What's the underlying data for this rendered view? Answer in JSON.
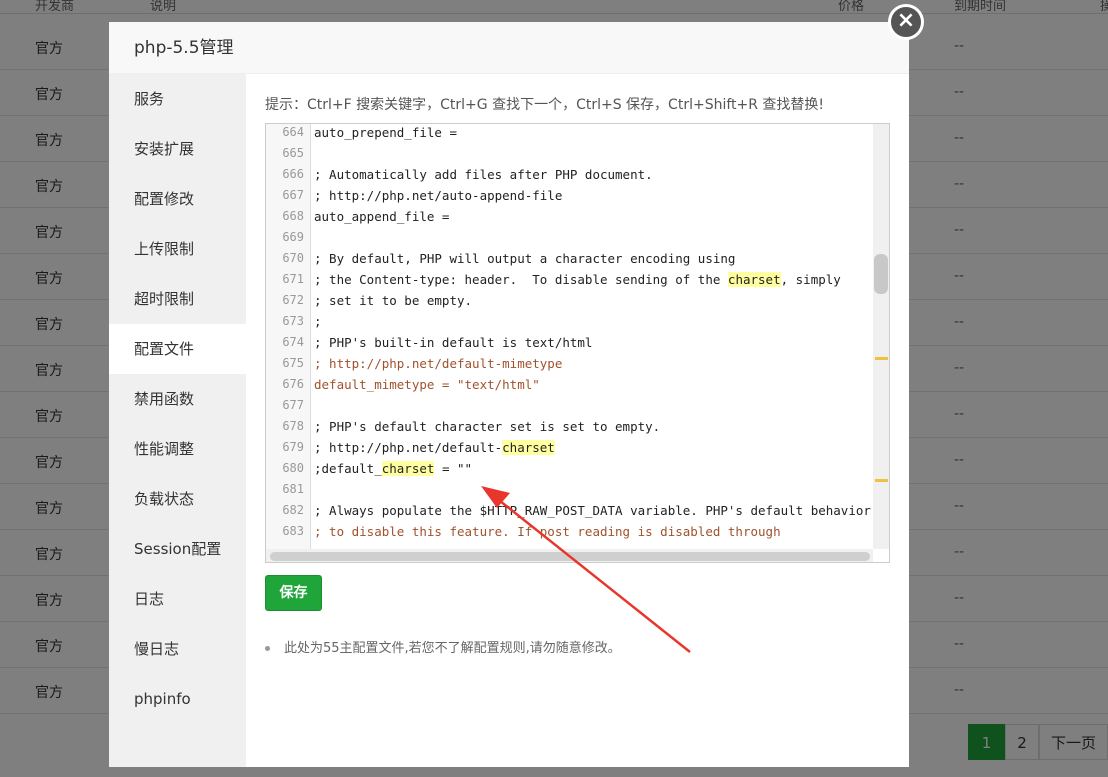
{
  "background": {
    "header": {
      "col1": "开发商",
      "col2": "说明",
      "col3": "价格",
      "col4": "到期时间",
      "col5": "操"
    },
    "rows": [
      {
        "vendor": "官方",
        "expiry": "--"
      },
      {
        "vendor": "官方",
        "expiry": "--"
      },
      {
        "vendor": "官方",
        "expiry": "--"
      },
      {
        "vendor": "官方",
        "expiry": "--"
      },
      {
        "vendor": "官方",
        "expiry": "--"
      },
      {
        "vendor": "官方",
        "expiry": "--"
      },
      {
        "vendor": "官方",
        "expiry": "--"
      },
      {
        "vendor": "官方",
        "expiry": "--"
      },
      {
        "vendor": "官方",
        "expiry": "--"
      },
      {
        "vendor": "官方",
        "expiry": "--"
      },
      {
        "vendor": "官方",
        "expiry": "--"
      },
      {
        "vendor": "官方",
        "expiry": "--"
      },
      {
        "vendor": "官方",
        "expiry": "--"
      },
      {
        "vendor": "官方",
        "expiry": "--"
      },
      {
        "vendor": "官方",
        "expiry": "--"
      }
    ],
    "pager": {
      "page1": "1",
      "page2": "2",
      "next": "下一页"
    }
  },
  "modal": {
    "title": "php-5.5管理",
    "close_label": "×",
    "sidebar": [
      {
        "label": "服务"
      },
      {
        "label": "安装扩展"
      },
      {
        "label": "配置修改"
      },
      {
        "label": "上传限制"
      },
      {
        "label": "超时限制"
      },
      {
        "label": "配置文件",
        "active": true
      },
      {
        "label": "禁用函数"
      },
      {
        "label": "性能调整"
      },
      {
        "label": "负载状态"
      },
      {
        "label": "Session配置"
      },
      {
        "label": "日志"
      },
      {
        "label": "慢日志"
      },
      {
        "label": "phpinfo"
      }
    ],
    "tip": "提示：Ctrl+F 搜索关键字，Ctrl+G 查找下一个，Ctrl+S 保存，Ctrl+Shift+R 查找替换!",
    "editor_lines": [
      {
        "n": "664",
        "t": "auto_prepend_file =",
        "c": false
      },
      {
        "n": "665",
        "t": "",
        "c": false
      },
      {
        "n": "666",
        "t": "; Automatically add files after PHP document.",
        "c": false
      },
      {
        "n": "667",
        "t": "; http://php.net/auto-append-file",
        "c": false
      },
      {
        "n": "668",
        "t": "auto_append_file =",
        "c": false
      },
      {
        "n": "669",
        "t": "",
        "c": false
      },
      {
        "n": "670",
        "t": "; By default, PHP will output a character encoding using",
        "c": false
      },
      {
        "n": "671",
        "t": "; the Content-type: header.  To disable sending of the charset, simply",
        "c": false
      },
      {
        "n": "672",
        "t": "; set it to be empty.",
        "c": false
      },
      {
        "n": "673",
        "t": ";",
        "c": false
      },
      {
        "n": "674",
        "t": "; PHP's built-in default is text/html",
        "c": false
      },
      {
        "n": "675",
        "t": "; http://php.net/default-mimetype",
        "c": true
      },
      {
        "n": "676",
        "t": "default_mimetype = \"text/html\"",
        "c": true
      },
      {
        "n": "677",
        "t": "",
        "c": false
      },
      {
        "n": "678",
        "t": "; PHP's default character set is set to empty.",
        "c": false
      },
      {
        "n": "679",
        "t": "; http://php.net/default-charset",
        "c": false
      },
      {
        "n": "680",
        "t": ";default_charset = \"\"",
        "c": false
      },
      {
        "n": "681",
        "t": "",
        "c": false
      },
      {
        "n": "682",
        "t": "; Always populate the $HTTP_RAW_POST_DATA variable. PHP's default behavior",
        "c": false
      },
      {
        "n": "683",
        "t": "; to disable this feature. If post reading is disabled through",
        "c": true
      }
    ],
    "save_label": "保存",
    "note": "此处为55主配置文件,若您不了解配置规则,请勿随意修改。"
  }
}
